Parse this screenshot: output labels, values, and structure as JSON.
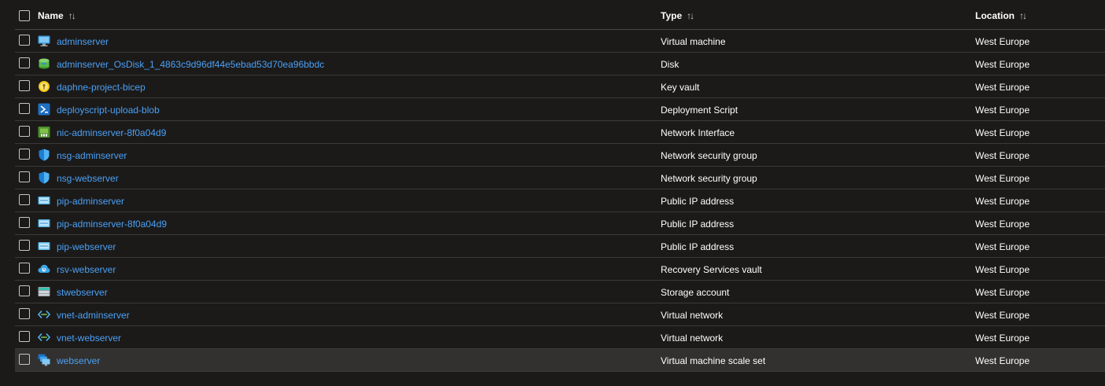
{
  "header": {
    "name_label": "Name",
    "type_label": "Type",
    "location_label": "Location",
    "sort_glyph": "↑↓"
  },
  "rows": [
    {
      "name": "adminserver",
      "type": "Virtual machine",
      "location": "West Europe",
      "icon": "virtual-machine-icon"
    },
    {
      "name": "adminserver_OsDisk_1_4863c9d96df44e5ebad53d70ea96bbdc",
      "type": "Disk",
      "location": "West Europe",
      "icon": "disk-icon"
    },
    {
      "name": "daphne-project-bicep",
      "type": "Key vault",
      "location": "West Europe",
      "icon": "key-vault-icon"
    },
    {
      "name": "deployscript-upload-blob",
      "type": "Deployment Script",
      "location": "West Europe",
      "icon": "deployment-script-icon"
    },
    {
      "name": "nic-adminserver-8f0a04d9",
      "type": "Network Interface",
      "location": "West Europe",
      "icon": "network-interface-icon"
    },
    {
      "name": "nsg-adminserver",
      "type": "Network security group",
      "location": "West Europe",
      "icon": "shield-icon"
    },
    {
      "name": "nsg-webserver",
      "type": "Network security group",
      "location": "West Europe",
      "icon": "shield-icon"
    },
    {
      "name": "pip-adminserver",
      "type": "Public IP address",
      "location": "West Europe",
      "icon": "public-ip-icon"
    },
    {
      "name": "pip-adminserver-8f0a04d9",
      "type": "Public IP address",
      "location": "West Europe",
      "icon": "public-ip-icon"
    },
    {
      "name": "pip-webserver",
      "type": "Public IP address",
      "location": "West Europe",
      "icon": "public-ip-icon"
    },
    {
      "name": "rsv-webserver",
      "type": "Recovery Services vault",
      "location": "West Europe",
      "icon": "recovery-vault-icon"
    },
    {
      "name": "stwebserver",
      "type": "Storage account",
      "location": "West Europe",
      "icon": "storage-account-icon"
    },
    {
      "name": "vnet-adminserver",
      "type": "Virtual network",
      "location": "West Europe",
      "icon": "virtual-network-icon"
    },
    {
      "name": "vnet-webserver",
      "type": "Virtual network",
      "location": "West Europe",
      "icon": "virtual-network-icon"
    },
    {
      "name": "webserver",
      "type": "Virtual machine scale set",
      "location": "West Europe",
      "icon": "vm-scale-set-icon",
      "selected": true
    }
  ],
  "colors": {
    "background": "#1b1a19",
    "link": "#4ba0f5",
    "selected_row": "#323130"
  }
}
